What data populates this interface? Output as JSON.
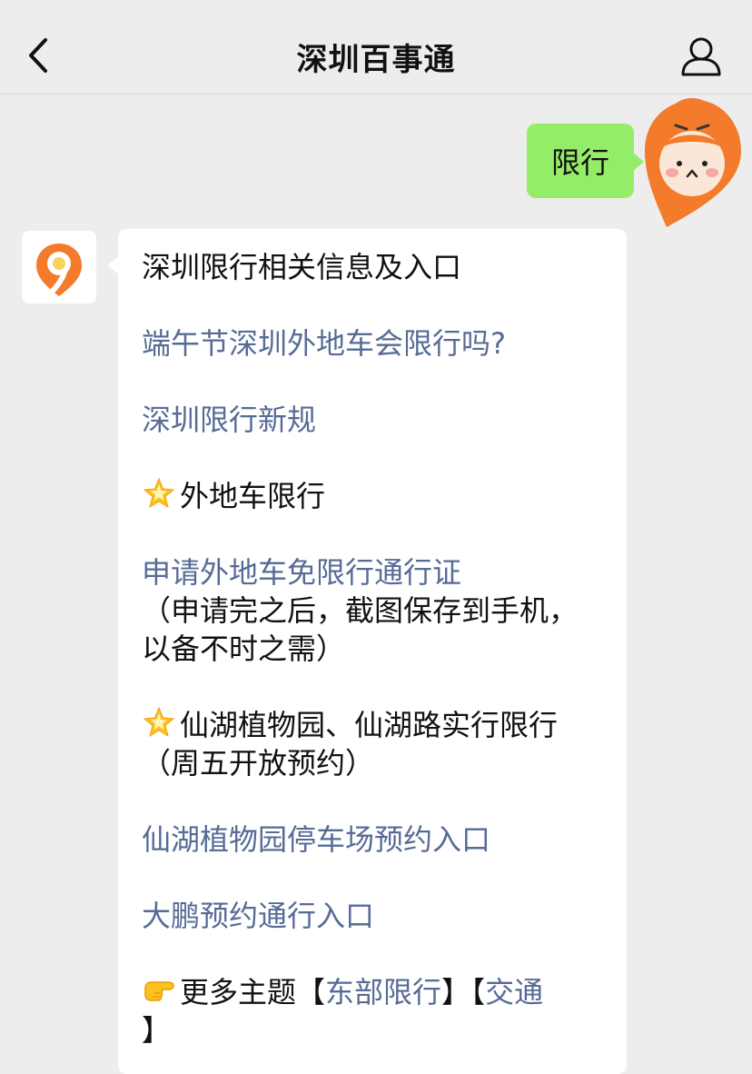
{
  "header": {
    "title": "深圳百事通"
  },
  "user_message": {
    "text": "限行"
  },
  "bot_message": {
    "heading": "深圳限行相关信息及入口",
    "link1": "端午节深圳外地车会限行吗?",
    "link2": "深圳限行新规",
    "section1_title": "外地车限行",
    "link3": "申请外地车免限行通行证",
    "note1_line1": "（申请完之后，截图保存到手机，",
    "note1_line2": "以备不时之需）",
    "section2_title": "仙湖植物园、仙湖路实行限行",
    "note2": "（周五开放预约）",
    "link4": "仙湖植物园停车场预约入口",
    "link5": "大鹏预约通行入口",
    "more_prefix": "更多主题",
    "bracket_open_1": "【",
    "topic1": "东部限行",
    "bracket_close_1": "】",
    "bracket_open_2": "【",
    "topic2": "交通",
    "bracket_close_2": "】"
  },
  "colors": {
    "link": "#576b95",
    "outgoing_bubble": "#95ec69",
    "background": "#ededed",
    "brand_orange": "#f47a2c"
  },
  "icons": {
    "back": "chevron-left-icon",
    "profile": "person-icon",
    "star_emoji": "glowing-star-emoji",
    "pointing_emoji": "pointing-right-emoji",
    "bot_logo": "location-pin-logo"
  }
}
